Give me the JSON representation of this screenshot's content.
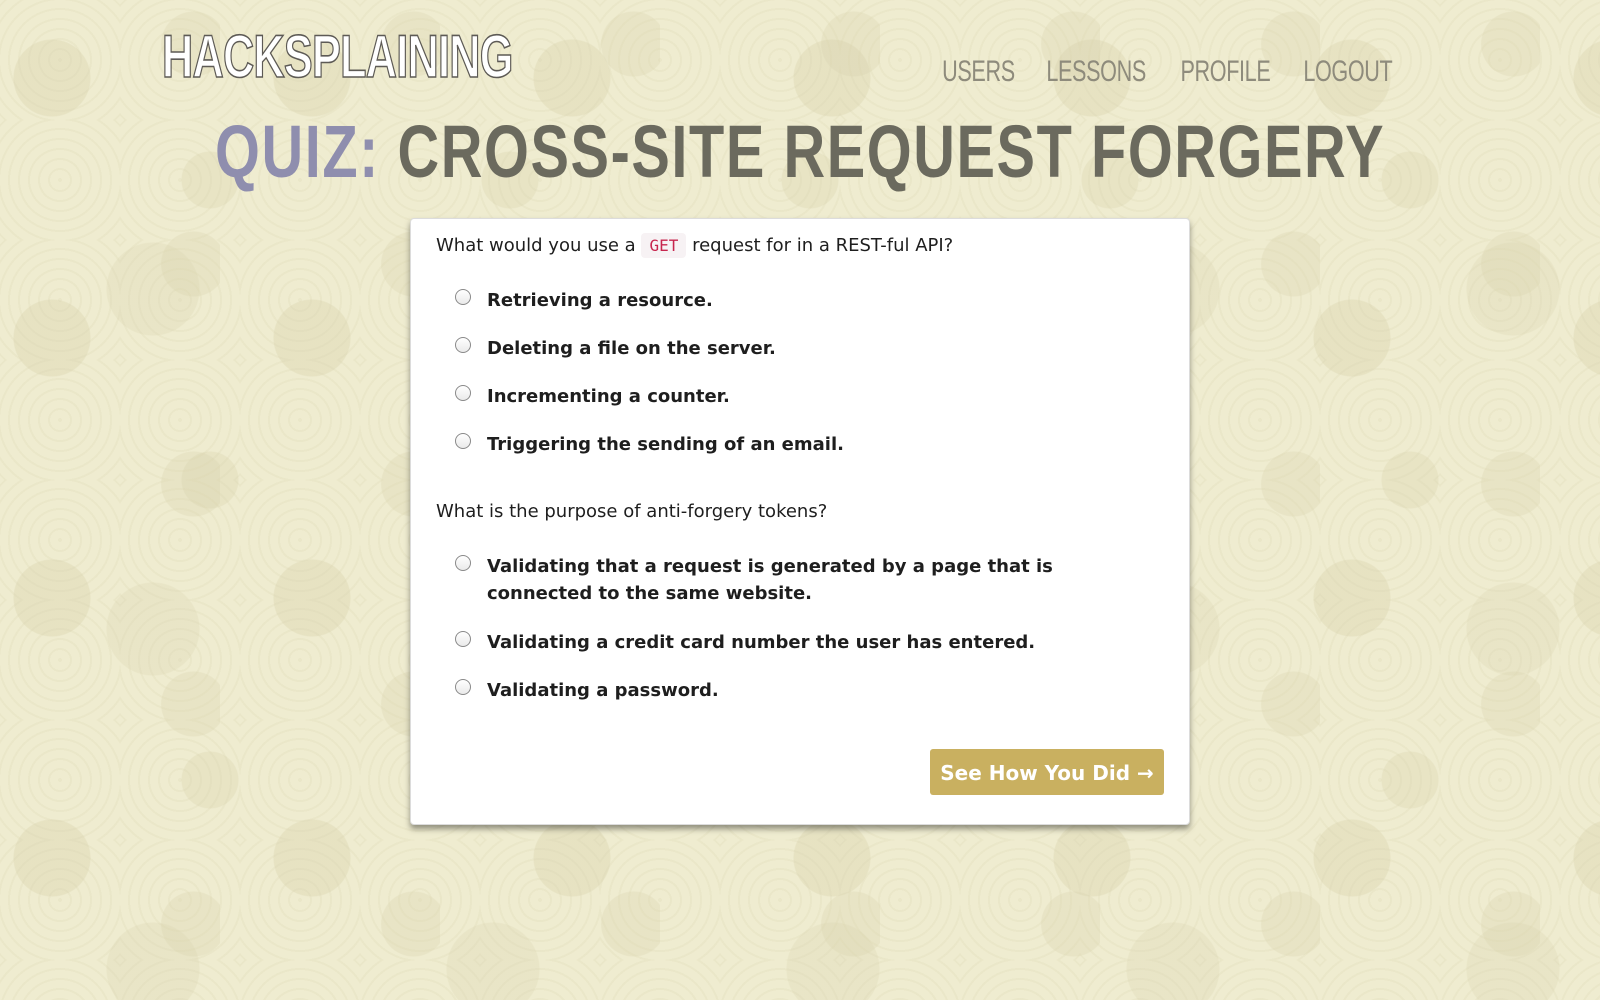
{
  "header": {
    "logo": "HACKSPLAINING",
    "nav": [
      "USERS",
      "LESSONS",
      "PROFILE",
      "LOGOUT"
    ]
  },
  "title": {
    "prefix": "QUIZ:",
    "topic": "CROSS-SITE REQUEST FORGERY"
  },
  "questions": [
    {
      "text_before": "What would you use a",
      "code": "GET",
      "text_after": "request for in a REST-ful API?",
      "options": [
        "Retrieving a resource.",
        "Deleting a file on the server.",
        "Incrementing a counter.",
        "Triggering the sending of an email."
      ]
    },
    {
      "text": "What is the purpose of anti-forgery tokens?",
      "options": [
        "Validating that a request is generated by a page that is connected to the same website.",
        "Validating a credit card number the user has entered.",
        "Validating a password."
      ]
    }
  ],
  "submit_label": "See How You Did →",
  "colors": {
    "background": "#efecd0",
    "quiz_label": "#8f8eae",
    "title_topic": "#6b6a5e",
    "button": "#c9b060",
    "code_text": "#c7254e"
  }
}
